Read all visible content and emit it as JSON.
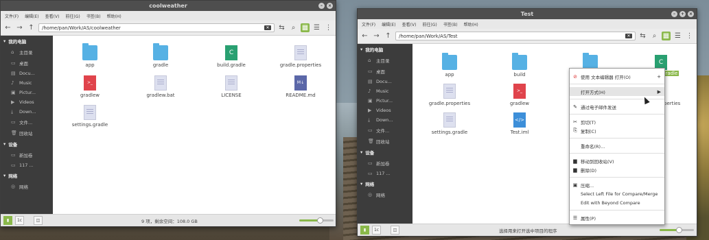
{
  "win1": {
    "title": "coolweather",
    "menus": [
      "文件(F)",
      "编辑(E)",
      "查看(V)",
      "前往(G)",
      "书签(B)",
      "帮助(H)"
    ],
    "path": "/home/pan/Work/AS/coolweather",
    "sidebar": {
      "my_computer": "我的电脑",
      "places": [
        "主目录",
        "桌面",
        "Docu...",
        "Music",
        "Pictur...",
        "Videos",
        "Down...",
        "文件...",
        "回收站"
      ],
      "devices": "设备",
      "device_items": [
        "新加卷",
        "117 ..."
      ],
      "network": "网络",
      "network_items": [
        "网络"
      ]
    },
    "files": [
      "app",
      "gradle",
      "build.gradle",
      "gradle.properties",
      "gradlew",
      "gradlew.bat",
      "LICENSE",
      "README.md",
      "settings.gradle"
    ],
    "status": "9 项，剩余空间：108.0 GB",
    "zoom_fraction": 0.6
  },
  "win2": {
    "title": "Test",
    "menus": [
      "文件(F)",
      "编辑(E)",
      "查看(V)",
      "前往(G)",
      "书签(B)",
      "帮助(H)"
    ],
    "path": "/home/pan/Work/AS/Test",
    "sidebar": {
      "my_computer": "我的电脑",
      "places": [
        "主目录",
        "桌面",
        "Docu...",
        "Music",
        "Pictur...",
        "Videos",
        "Down...",
        "文件...",
        "回收站"
      ],
      "devices": "设备",
      "device_items": [
        "新加卷",
        "117 ..."
      ],
      "network": "网络",
      "network_items": [
        "网络"
      ]
    },
    "files": [
      "app",
      "build",
      "",
      "",
      "gradle.properties",
      "gradlew",
      "",
      "",
      "settings.gradle",
      "Test.iml"
    ],
    "status": "选择用来打开选中项目的程序",
    "zoom_fraction": 0.55,
    "partial_labels": {
      "gradle": "gradle",
      "properties": "perties"
    }
  },
  "context_menu": {
    "items": [
      {
        "label": "使用 文本编辑器 打开(O)",
        "icon": "text-editor-icon",
        "trail": "+"
      },
      {
        "label": "打开方式(H)",
        "icon": "",
        "trail": "▶",
        "highlight": true
      },
      {
        "label": "通过电子邮件发送",
        "icon": "paperclip-icon",
        "trail": ""
      },
      {
        "label": "剪切(T)",
        "icon": "scissors-icon",
        "trail": ""
      },
      {
        "label": "复制(C)",
        "icon": "copy-icon",
        "trail": ""
      },
      {
        "label": "重命名(R)...",
        "icon": "",
        "trail": ""
      },
      {
        "label": "移动到回收站(V)",
        "icon": "trash-icon",
        "trail": ""
      },
      {
        "label": "删除(D)",
        "icon": "delete-icon",
        "trail": ""
      },
      {
        "label": "压缩...",
        "icon": "archive-icon",
        "trail": ""
      },
      {
        "label": "Select Left File for Compare/Merge",
        "icon": "",
        "trail": ""
      },
      {
        "label": "Edit with Beyond Compare",
        "icon": "",
        "trail": ""
      },
      {
        "label": "属性(P)",
        "icon": "properties-icon",
        "trail": ""
      }
    ]
  },
  "colors": {
    "accent": "#8ab84a",
    "sidebar": "#3c3c3c",
    "folder": "#56b1e4"
  },
  "status_buttons": [
    "1c"
  ]
}
